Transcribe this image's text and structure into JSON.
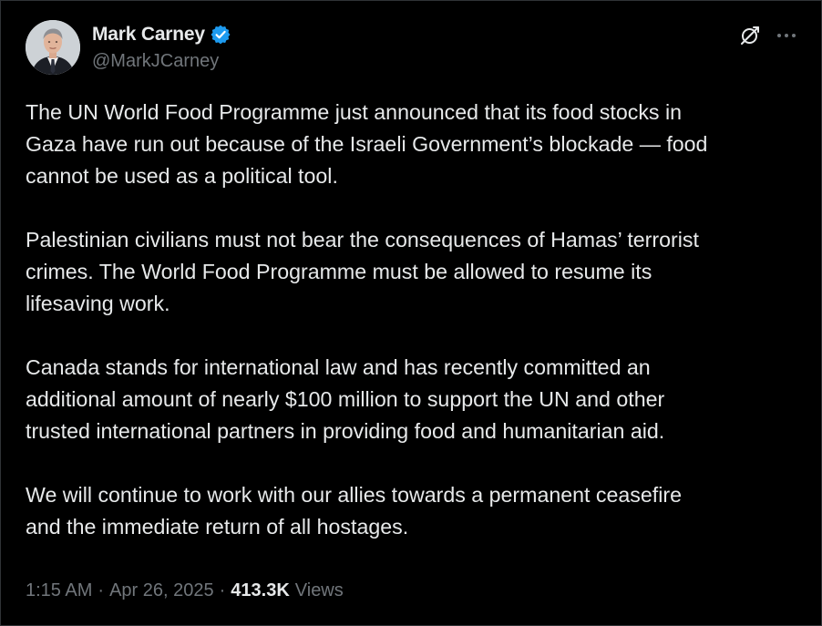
{
  "author": {
    "display_name": "Mark Carney",
    "handle": "@MarkJCarney",
    "verified_color": "#1d9bf0"
  },
  "actions": {
    "grok_icon": "grok-icon",
    "more_icon": "more-icon"
  },
  "tweet": {
    "paragraphs": [
      "The UN World Food Programme just announced that its food stocks in\nGaza have run out because of the Israeli Government’s blockade — food\ncannot be used as a political tool.",
      "Palestinian civilians must not bear the consequences of Hamas’ terrorist\ncrimes. The World Food Programme must be allowed to resume its\nlifesaving work.",
      "Canada stands for international law and has recently committed an\nadditional amount of nearly $100 million to support the UN and other\ntrusted international partners in providing food and humanitarian aid.",
      "We will continue to work with our allies towards a permanent ceasefire\nand the immediate return of all hostages."
    ]
  },
  "meta": {
    "time": "1:15 AM",
    "separator": "·",
    "date": "Apr 26, 2025",
    "views_count": "413.3K",
    "views_label": "Views"
  },
  "colors": {
    "background": "#000000",
    "text_primary": "#e7e9ea",
    "text_secondary": "#71767b",
    "accent": "#1d9bf0"
  }
}
